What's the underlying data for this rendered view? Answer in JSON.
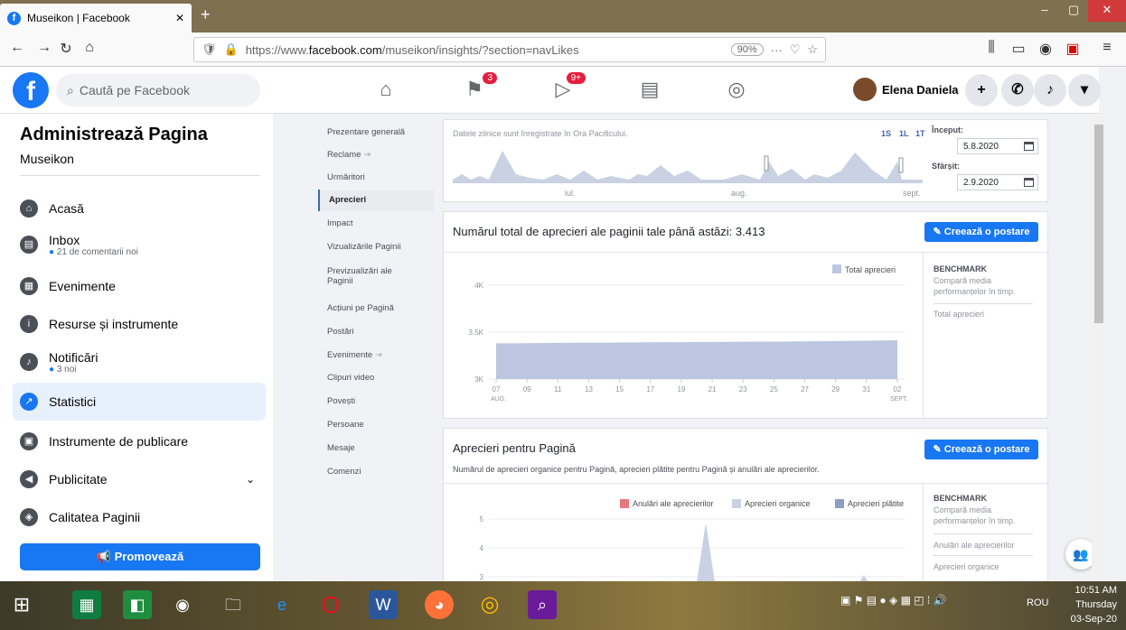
{
  "browser": {
    "tab_title": "Museikon | Facebook",
    "url_prefix": "https://www.",
    "url_domain": "facebook.com",
    "url_path": "/museikon/insights/?section=navLikes",
    "zoom": "90%",
    "new_tab": "+"
  },
  "fb": {
    "search_placeholder": "Caută pe Facebook",
    "notif_badge": "3",
    "video_badge": "9+",
    "user_name": "Elena Daniela"
  },
  "sidebar": {
    "title": "Administrează Pagina",
    "page_name": "Museikon",
    "items": [
      {
        "label": "Acasă",
        "sub": ""
      },
      {
        "label": "Inbox",
        "sub": "21 de comentarii noi"
      },
      {
        "label": "Evenimente",
        "sub": ""
      },
      {
        "label": "Resurse și instrumente",
        "sub": ""
      },
      {
        "label": "Notificări",
        "sub": "3 noi"
      },
      {
        "label": "Statistici",
        "sub": ""
      },
      {
        "label": "Instrumente de publicare",
        "sub": ""
      },
      {
        "label": "Publicitate",
        "sub": ""
      },
      {
        "label": "Calitatea Paginii",
        "sub": ""
      }
    ],
    "promo": "Promovează"
  },
  "insights_nav": [
    "Prezentare generală",
    "Reclame",
    "Urmăritori",
    "Aprecieri",
    "Impact",
    "Vizualizările Paginii",
    "Previzualizări ale Paginii",
    "Acțiuni pe Pagină",
    "Postări",
    "Evenimente",
    "Clipuri video",
    "Povești",
    "Persoane",
    "Mesaje",
    "Comenzi"
  ],
  "range": {
    "note": "Datele zilnice sunt înregistrate în Ora Pacificului.",
    "periods": [
      "1S",
      "1L",
      "1T"
    ],
    "start_label": "Început:",
    "start": "5.8.2020",
    "end_label": "Sfârșit:",
    "end": "2.9.2020",
    "months": [
      "iul.",
      "aug.",
      "sept."
    ]
  },
  "card1": {
    "title": "Numărul total de aprecieri ale paginii tale până astăzi: 3.413",
    "button": "Creează o postare",
    "legend": "Total aprecieri",
    "bench_title": "BENCHMARK",
    "bench_text": "Compară media performanțelor în timp.",
    "bench_item": "Total aprecieri"
  },
  "card2": {
    "title": "Aprecieri pentru Pagină",
    "subtitle": "Numărul de aprecieri organice pentru Pagină, aprecieri plătite pentru Pagină și anulări ale aprecierilor.",
    "button": "Creează o postare",
    "legend": [
      "Anulări ale aprecierilor",
      "Aprecieri organice",
      "Aprecieri plătite"
    ],
    "bench_title": "BENCHMARK",
    "bench_text": "Compară media performanțelor în timp.",
    "bench_items": [
      "Anulări ale aprecierilor",
      "Aprecieri organice"
    ]
  },
  "taskbar": {
    "lang": "ROU",
    "time": "10:51 AM",
    "day": "Thursday",
    "date": "03-Sep-20"
  },
  "chart_data": [
    {
      "type": "area",
      "title": "",
      "xlabel": "",
      "ylabel": "",
      "categories": [
        "07",
        "09",
        "11",
        "13",
        "15",
        "17",
        "19",
        "21",
        "23",
        "25",
        "27",
        "29",
        "31",
        "02"
      ],
      "month_labels": [
        "AUG.",
        "SEPT."
      ],
      "yticks": [
        "3K",
        "3.5K",
        "4K"
      ],
      "ylim": [
        3000,
        4200
      ],
      "series": [
        {
          "name": "Total aprecieri",
          "color": "#bcc6e0",
          "values": [
            3380,
            3382,
            3385,
            3387,
            3389,
            3391,
            3393,
            3395,
            3397,
            3399,
            3401,
            3404,
            3408,
            3413
          ]
        }
      ]
    },
    {
      "type": "area",
      "title": "",
      "yticks": [
        "3",
        "4",
        "5"
      ],
      "series": [
        {
          "name": "Anulări ale aprecierilor",
          "color": "#e8777f"
        },
        {
          "name": "Aprecieri organice",
          "color": "#c9d1e3"
        },
        {
          "name": "Aprecieri plătite",
          "color": "#8e9cc4"
        }
      ]
    }
  ]
}
